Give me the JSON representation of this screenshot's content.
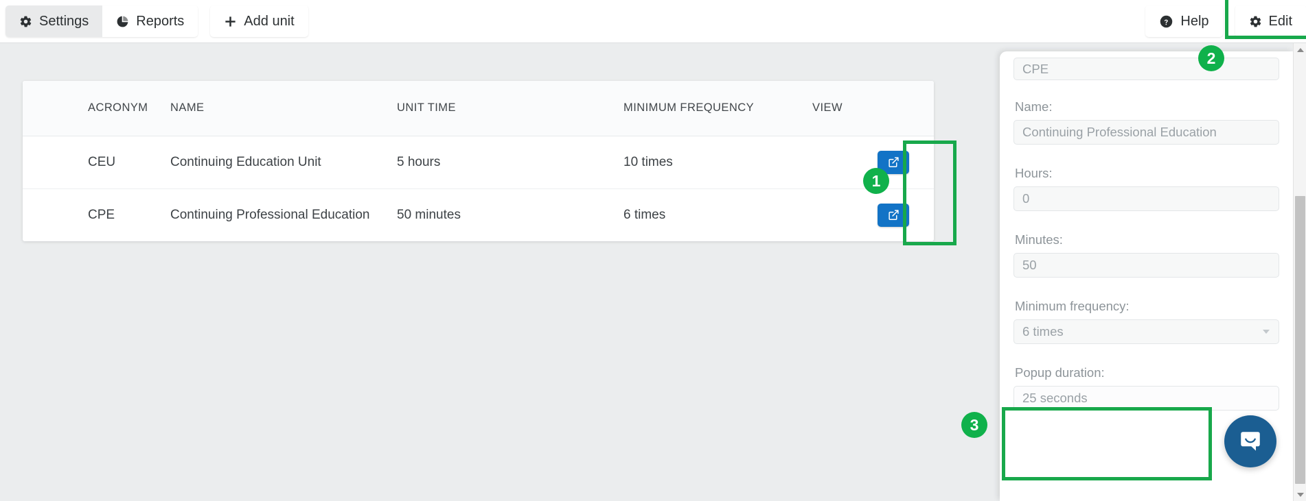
{
  "toolbar": {
    "settings_label": "Settings",
    "reports_label": "Reports",
    "add_unit_label": "Add unit",
    "help_label": "Help",
    "edit_label": "Edit"
  },
  "table": {
    "columns": [
      "ACRONYM",
      "NAME",
      "UNIT TIME",
      "MINIMUM FREQUENCY",
      "VIEW"
    ],
    "rows": [
      {
        "acronym": "CEU",
        "name": "Continuing Education Unit",
        "unit_time": "5 hours",
        "minimum_frequency": "10 times"
      },
      {
        "acronym": "CPE",
        "name": "Continuing Professional Education",
        "unit_time": "50 minutes",
        "minimum_frequency": "6 times"
      }
    ]
  },
  "panel": {
    "acronym_value": "CPE",
    "name_label": "Name:",
    "name_value": "Continuing Professional Education",
    "hours_label": "Hours:",
    "hours_value": "0",
    "minutes_label": "Minutes:",
    "minutes_value": "50",
    "minimum_frequency_label": "Minimum frequency:",
    "minimum_frequency_value": "6 times",
    "popup_duration_label": "Popup duration:",
    "popup_duration_value": "25 seconds"
  },
  "annotations": {
    "badge1": "1",
    "badge2": "2",
    "badge3": "3"
  },
  "colors": {
    "accent_green": "#10b14b",
    "button_blue": "#1273c6",
    "intercom_blue": "#1b5e92",
    "page_background": "#ebedee"
  }
}
